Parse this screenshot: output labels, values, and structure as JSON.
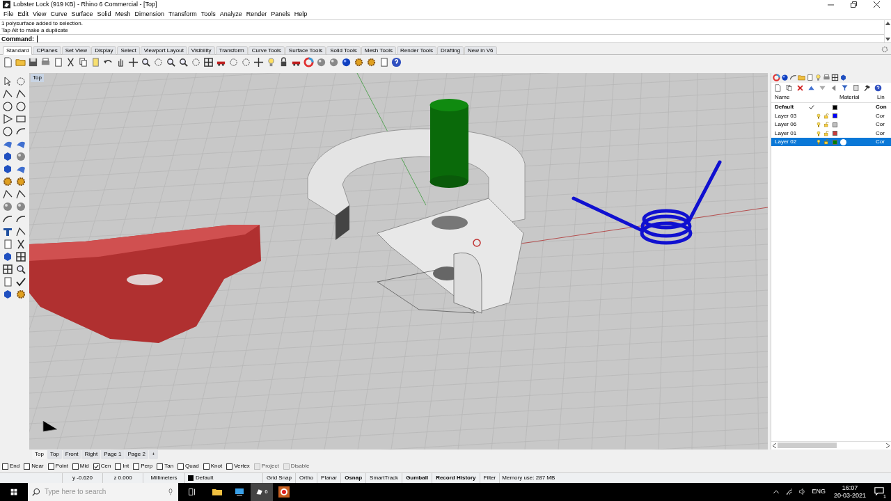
{
  "window": {
    "title": "Lobster Lock (919 KB) - Rhino 6 Commercial - [Top]"
  },
  "menu": [
    "File",
    "Edit",
    "View",
    "Curve",
    "Surface",
    "Solid",
    "Mesh",
    "Dimension",
    "Transform",
    "Tools",
    "Analyze",
    "Render",
    "Panels",
    "Help"
  ],
  "command_history": [
    "1 polysurface added to selection.",
    "Tap Alt to make a duplicate"
  ],
  "command": {
    "label": "Command:"
  },
  "toolbar_tabs": [
    {
      "label": "Standard",
      "selected": true
    },
    {
      "label": "CPlanes",
      "selected": false
    },
    {
      "label": "Set View",
      "selected": false
    },
    {
      "label": "Display",
      "selected": false
    },
    {
      "label": "Select",
      "selected": false
    },
    {
      "label": "Viewport Layout",
      "selected": false
    },
    {
      "label": "Visibility",
      "selected": false
    },
    {
      "label": "Transform",
      "selected": false
    },
    {
      "label": "Curve Tools",
      "selected": false
    },
    {
      "label": "Surface Tools",
      "selected": false
    },
    {
      "label": "Solid Tools",
      "selected": false
    },
    {
      "label": "Mesh Tools",
      "selected": false
    },
    {
      "label": "Render Tools",
      "selected": false
    },
    {
      "label": "Drafting",
      "selected": false
    },
    {
      "label": "New in V6",
      "selected": false
    }
  ],
  "viewport": {
    "label": "Top"
  },
  "layers": {
    "columns": [
      "Name",
      "Material",
      "Lin"
    ],
    "rows": [
      {
        "name": "Default",
        "current": true,
        "color": "#000000",
        "selected": false,
        "material": false,
        "linetype": "Con"
      },
      {
        "name": "Layer 03",
        "current": false,
        "color": "#0000ff",
        "selected": false,
        "material": false,
        "linetype": "Cor"
      },
      {
        "name": "Layer 06",
        "current": false,
        "color": "#c0c0c0",
        "selected": false,
        "material": false,
        "linetype": "Cor"
      },
      {
        "name": "Layer 01",
        "current": false,
        "color": "#c83c3c",
        "selected": false,
        "material": false,
        "linetype": "Cor"
      },
      {
        "name": "Layer 02",
        "current": false,
        "color": "#008000",
        "selected": true,
        "material": true,
        "linetype": "Cor"
      }
    ]
  },
  "viewport_tabs": [
    {
      "label": "Top",
      "selected": true
    },
    {
      "label": "Top",
      "selected": false
    },
    {
      "label": "Front",
      "selected": false
    },
    {
      "label": "Right",
      "selected": false
    },
    {
      "label": "Page 1",
      "selected": false
    },
    {
      "label": "Page 2",
      "selected": false
    },
    {
      "label": "+",
      "selected": false
    }
  ],
  "osnaps": [
    {
      "label": "End",
      "checked": false,
      "disabled": false
    },
    {
      "label": "Near",
      "checked": false,
      "disabled": false
    },
    {
      "label": "Point",
      "checked": false,
      "disabled": false
    },
    {
      "label": "Mid",
      "checked": false,
      "disabled": false
    },
    {
      "label": "Cen",
      "checked": true,
      "disabled": false
    },
    {
      "label": "Int",
      "checked": false,
      "disabled": false
    },
    {
      "label": "Perp",
      "checked": false,
      "disabled": false
    },
    {
      "label": "Tan",
      "checked": false,
      "disabled": false
    },
    {
      "label": "Quad",
      "checked": false,
      "disabled": false
    },
    {
      "label": "Knot",
      "checked": false,
      "disabled": false
    },
    {
      "label": "Vertex",
      "checked": false,
      "disabled": false
    },
    {
      "label": "Project",
      "checked": false,
      "disabled": true
    },
    {
      "label": "Disable",
      "checked": false,
      "disabled": true
    }
  ],
  "status_bar": {
    "y": "y -0.620",
    "z": "z 0.000",
    "units": "Millimeters",
    "layer": {
      "name": "Default",
      "color": "#000000"
    },
    "toggles": [
      {
        "label": "Grid Snap",
        "on": false
      },
      {
        "label": "Ortho",
        "on": false
      },
      {
        "label": "Planar",
        "on": false
      },
      {
        "label": "Osnap",
        "on": true
      },
      {
        "label": "SmartTrack",
        "on": false
      },
      {
        "label": "Gumball",
        "on": true
      },
      {
        "label": "Record History",
        "on": true
      },
      {
        "label": "Filter",
        "on": false
      }
    ],
    "memory": "Memory use: 287 MB"
  },
  "taskbar": {
    "search_placeholder": "Type here to search",
    "rhino_badge": "6",
    "language": "ENG",
    "time": "16:07",
    "date": "20-03-2021",
    "notifications": "1"
  }
}
